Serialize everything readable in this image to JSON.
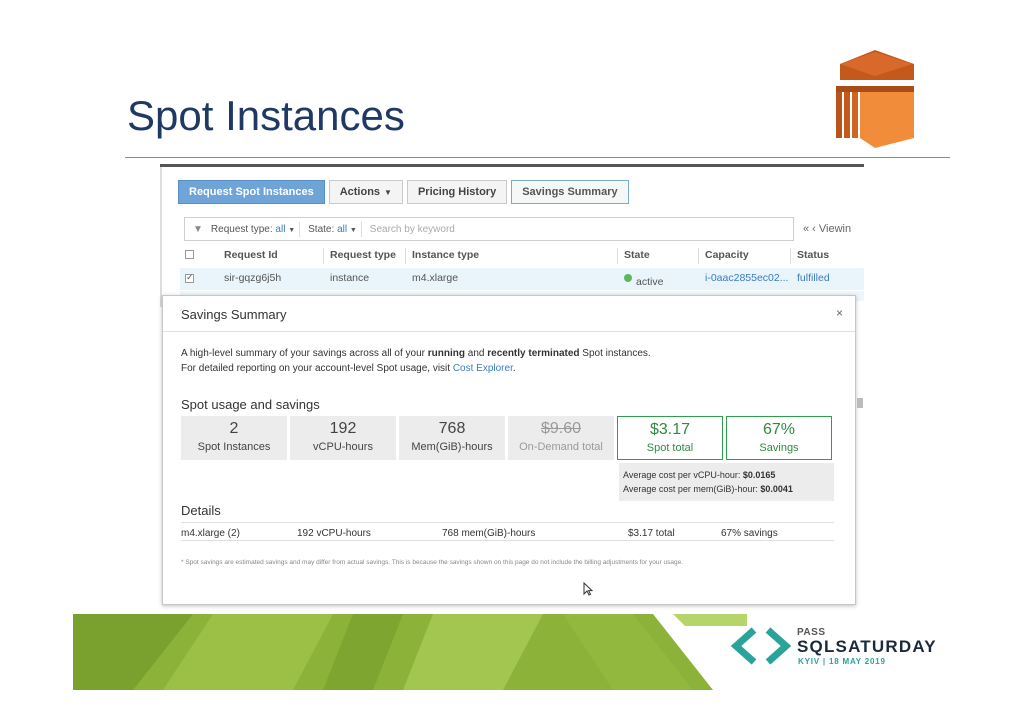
{
  "slide": {
    "title": "Spot Instances"
  },
  "toolbar": {
    "request_spot_label": "Request Spot Instances",
    "actions_label": "Actions",
    "pricing_history_label": "Pricing History",
    "savings_summary_label": "Savings Summary"
  },
  "filter": {
    "request_type_label": "Request type:",
    "request_type_value": "all",
    "state_label": "State:",
    "state_value": "all",
    "search_placeholder": "Search by keyword",
    "pager_text": "« ‹ Viewin"
  },
  "table": {
    "columns": [
      "Request Id",
      "Request type",
      "Instance type",
      "State",
      "Capacity",
      "Status"
    ],
    "rows": [
      {
        "request_id": "sir-gqzg6j5h",
        "request_type": "instance",
        "instance_type": "m4.xlarge",
        "state": "active",
        "capacity": "i-0aac2855ec02...",
        "status": "fulfilled"
      }
    ]
  },
  "modal": {
    "title": "Savings Summary",
    "close_label": "×",
    "intro_line1_a": "A high-level summary of your savings across all of your ",
    "intro_line1_b": "running",
    "intro_line1_c": " and ",
    "intro_line1_d": "recently terminated",
    "intro_line1_e": " Spot instances.",
    "intro_line2_a": "For detailed reporting on your account-level Spot usage, visit ",
    "intro_line2_link": "Cost Explorer",
    "intro_line2_end": ".",
    "usage_heading": "Spot usage and savings",
    "tiles": [
      {
        "value": "2",
        "label": "Spot Instances"
      },
      {
        "value": "192",
        "label": "vCPU-hours"
      },
      {
        "value": "768",
        "label": "Mem(GiB)-hours"
      },
      {
        "value": "$9.60",
        "label": "On-Demand total"
      },
      {
        "value": "$3.17",
        "label": "Spot total"
      },
      {
        "value": "67%",
        "label": "Savings"
      }
    ],
    "avg_vcpu_label": "Average cost per vCPU-hour:",
    "avg_vcpu_value": "$0.0165",
    "avg_mem_label": "Average cost per mem(GiB)-hour:",
    "avg_mem_value": "$0.0041",
    "details_heading": "Details",
    "details": {
      "instance": "m4.xlarge (2)",
      "vcpu": "192 vCPU-hours",
      "mem": "768 mem(GiB)-hours",
      "total": "$3.17 total",
      "savings": "67% savings"
    },
    "footnote": "* Spot savings are estimated savings and may differ from actual savings. This is because the savings shown on this page do not include the billing adjustments for your usage."
  },
  "footer": {
    "pass": "PASS",
    "sqlsaturday": "SQLSATURDAY",
    "event": "KYIV | 18 MAY 2019"
  },
  "colors": {
    "title": "#1f3864",
    "primary_button": "#6fa4d8",
    "link": "#3a7cc1",
    "savings_green": "#2e8b3f",
    "aws_orange": "#e8762c",
    "band_green": "#8cb23a",
    "logo_teal": "#2aa39a"
  }
}
